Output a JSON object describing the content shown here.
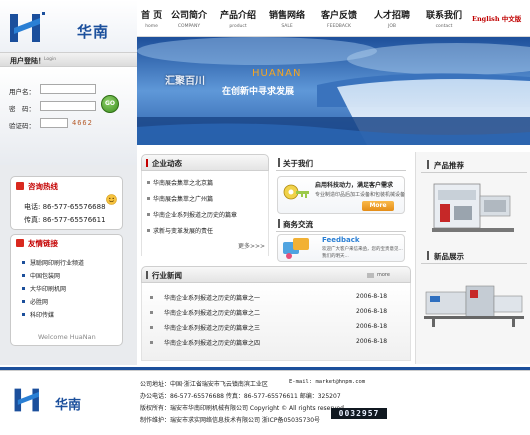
{
  "brand": {
    "logo_text": "华南",
    "footer_logo_text": "华南"
  },
  "nav": {
    "items": [
      {
        "label": "首 页",
        "sub": "home"
      },
      {
        "label": "公司简介",
        "sub": "COMPANY"
      },
      {
        "label": "产品介绍",
        "sub": "product"
      },
      {
        "label": "销售网络",
        "sub": "SALE"
      },
      {
        "label": "客户反馈",
        "sub": "FEEDBACK"
      },
      {
        "label": "人才招聘",
        "sub": "JOB"
      },
      {
        "label": "联系我们",
        "sub": "contact"
      }
    ],
    "lang": "English 中文版"
  },
  "banner": {
    "slogan_cn": "汇聚百川",
    "slogan_en": "HUANAN",
    "tagline": "在创新中寻求发展"
  },
  "login": {
    "title": "用户登陆！",
    "subtitle": "Login",
    "username_label": "用户名：",
    "password_label": "密　码：",
    "captcha_label": "验证码：",
    "captcha_value": "4662",
    "go_label": "GO"
  },
  "hotline": {
    "title": "咨询热线",
    "phone1": "电话: 86-577-65576688",
    "phone2": "传真: 86-577-65576611"
  },
  "links": {
    "title": "友情链接",
    "items": [
      "慧聪网印刷行业频道",
      "中国包装网",
      "大华印刷机网",
      "必胜网",
      "科印传媒"
    ],
    "welcome": "Welcome HuaNan"
  },
  "company_news": {
    "title": "企业动态",
    "items": [
      "华南展会集萃之北京篇",
      "华南展会集萃之广州篇",
      "华南企业系列报道之历史的篇章",
      "求新与变革发展的责任"
    ],
    "more": "更多>>>"
  },
  "industry_news": {
    "title": "行业新闻",
    "more": "more",
    "items": [
      {
        "title": "华南企业系列报道之历史的篇章之一",
        "date": "2006-8-18"
      },
      {
        "title": "华南企业系列报道之历史的篇章之二",
        "date": "2006-8-18"
      },
      {
        "title": "华南企业系列报道之历史的篇章之三",
        "date": "2006-8-18"
      },
      {
        "title": "华南企业系列报道之历史的篇章之四",
        "date": "2006-8-18"
      }
    ]
  },
  "about": {
    "title": "关于我们",
    "headline": "启用科技动力，满足客户需求",
    "text": "专业制造印品后加工设备和包装机械设备",
    "more": "More"
  },
  "feedback": {
    "title": "商务交流",
    "brand": "Feedback",
    "text": "欢迎广大客户来信来函，您的宝贵意见...",
    "text2": "我们的明天..."
  },
  "products": {
    "title": "产品推荐"
  },
  "new_products": {
    "title": "新品展示"
  },
  "footer": {
    "address": "公司地址：中国·浙江省瑞安市飞云镇南滨工业区",
    "email": "E-mail: market@hnpm.com",
    "phone": "办公电话：86-577-65576688   传真：86-577-65576611   邮编：325207",
    "copyright": "版权所有：瑞安市华南印刷机械有限公司   Copyright © All rights reserved",
    "maker": "制作维护：瑞安市求实网络信息技术有限公司  浙ICP备05035730号",
    "counter": "0032957"
  }
}
